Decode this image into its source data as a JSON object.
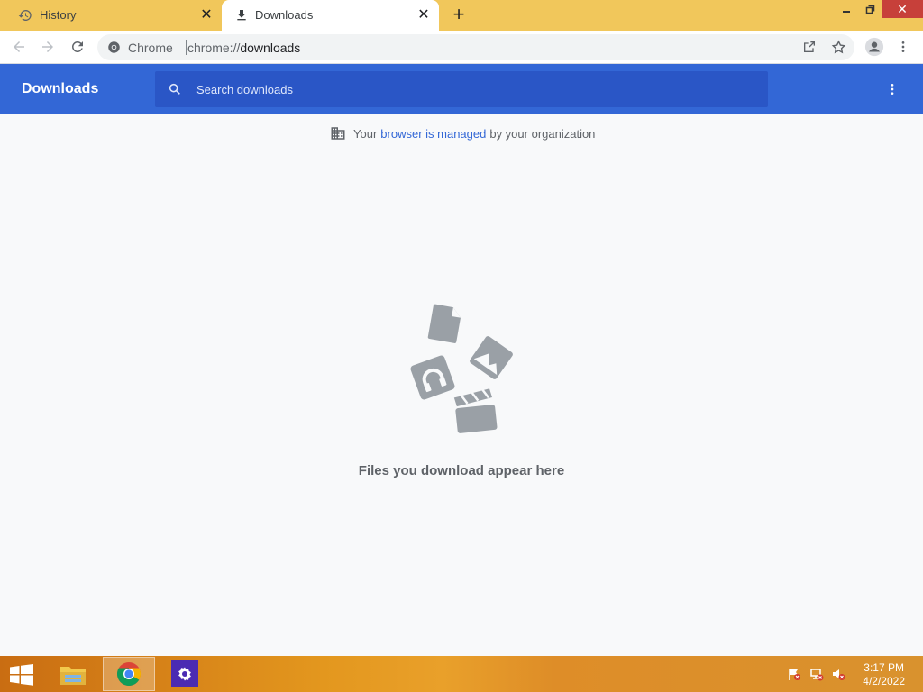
{
  "tabs": [
    {
      "title": "History",
      "icon": "history-icon"
    },
    {
      "title": "Downloads",
      "icon": "download-icon"
    }
  ],
  "omnibox": {
    "site": "Chrome",
    "url_prefix": "chrome://",
    "url_path": "downloads"
  },
  "header": {
    "title": "Downloads",
    "search_placeholder": "Search downloads"
  },
  "managed": {
    "prefix": "Your",
    "link": "browser is managed",
    "suffix": "by your organization"
  },
  "empty_state": {
    "message": "Files you download appear here"
  },
  "clock": {
    "time": "3:17 PM",
    "date": "4/2/2022"
  },
  "colors": {
    "tab_strip": "#f1c75b",
    "header_bg": "#3367d6",
    "search_bg": "#2a56c6",
    "page_bg": "#f8f9fa"
  }
}
